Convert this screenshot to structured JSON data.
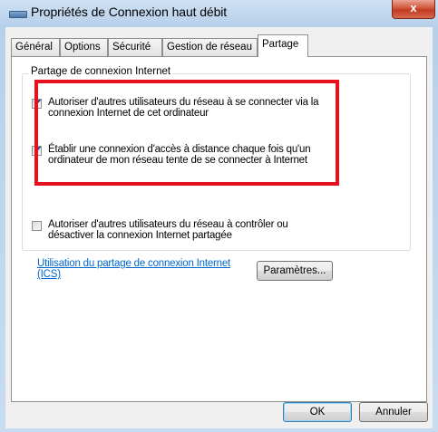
{
  "window": {
    "title": "Propriétés de Connexion haut débit",
    "close_label": "x"
  },
  "tabs": [
    {
      "label": "Général",
      "active": false
    },
    {
      "label": "Options",
      "active": false
    },
    {
      "label": "Sécurité",
      "active": false
    },
    {
      "label": "Gestion de réseau",
      "active": false
    },
    {
      "label": "Partage",
      "active": true
    }
  ],
  "group": {
    "title": "Partage de connexion Internet",
    "checkboxes": [
      {
        "label": "Autoriser d'autres utilisateurs du réseau à se connecter via la connexion Internet de cet ordinateur",
        "checked": true
      },
      {
        "label": "Établir une connexion d'accès à distance chaque fois qu'un ordinateur de mon réseau tente de se connecter à Internet",
        "checked": true
      },
      {
        "label": "Autoriser d'autres utilisateurs du réseau à contrôler ou désactiver la connexion Internet partagée",
        "checked": false
      }
    ],
    "ics_link": "Utilisation du partage de connexion Internet (ICS)",
    "settings_button": "Paramètres..."
  },
  "buttons": {
    "ok": "OK",
    "cancel": "Annuler"
  },
  "colors": {
    "highlight": "#e6101e",
    "link": "#0066cc"
  }
}
